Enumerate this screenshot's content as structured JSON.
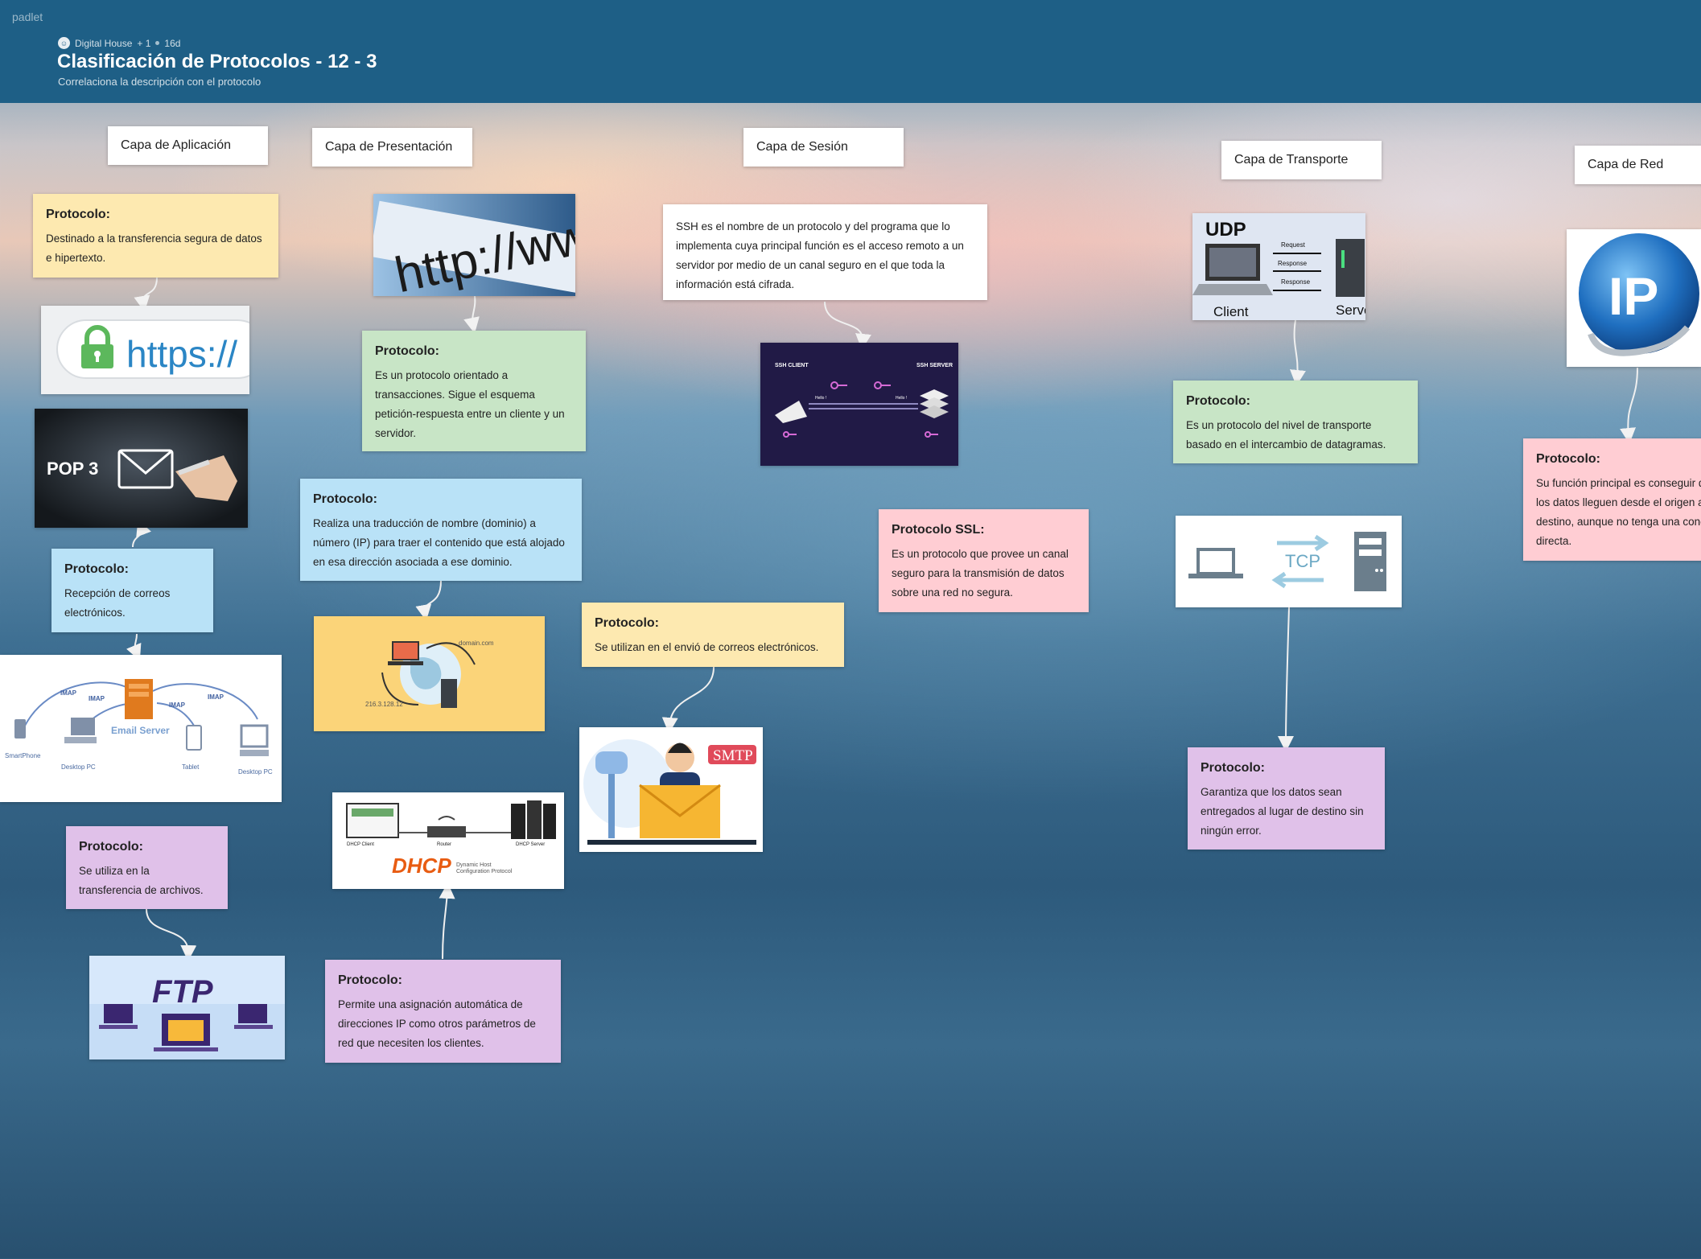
{
  "header": {
    "brand": "padlet",
    "author": "Digital House",
    "plus_count": "+ 1",
    "age": "16d",
    "title": "Clasificación de Protocolos - 12 - 3",
    "subtitle": "Correlaciona la descripción con el protocolo"
  },
  "columns": {
    "aplicacion": "Capa de Aplicación",
    "presentacion": "Capa de Presentación",
    "sesion": "Capa de Sesión",
    "transporte": "Capa de Transporte",
    "red": "Capa de Red"
  },
  "notes": {
    "https_title": "Protocolo:",
    "https_body": "Destinado a la transferencia segura de datos e hipertexto.",
    "pop3_title": "Protocolo:",
    "pop3_body": "Recepción de correos electrónicos.",
    "ftp_title": "Protocolo:",
    "ftp_body": "Se utiliza en la transferencia de archivos.",
    "http_title": "Protocolo:",
    "http_body": "Es un protocolo orientado a transacciones. Sigue el esquema petición-respuesta entre un cliente y un servidor.",
    "dns_title": "Protocolo:",
    "dns_body": "Realiza una traducción de nombre (dominio) a número (IP) para traer el contenido que está alojado en esa dirección asociada a ese dominio.",
    "dhcp_title": "Protocolo:",
    "dhcp_body": "Permite una asignación automática de direcciones IP como otros parámetros de red que necesiten los clientes.",
    "smtp_title": "Protocolo:",
    "smtp_body": "Se utilizan en el envió de correos electrónicos.",
    "ssh_body": "SSH es el nombre de un protocolo y del programa que lo implementa cuya principal función es el acceso remoto a un servidor por medio de un canal seguro en el que toda la información está cifrada.",
    "ssl_title": "Protocolo SSL:",
    "ssl_body": "Es un protocolo que provee un canal seguro para la transmisión de datos sobre una red no segura.",
    "udp_title": "Protocolo:",
    "udp_body": "Es un protocolo del nivel de transporte basado en el intercambio de datagramas.",
    "tcp_title": "Protocolo:",
    "tcp_body": "Garantiza que los datos sean entregados al lugar de destino sin ningún error.",
    "ip_title": "Protocolo:",
    "ip_body": "Su función principal es conseguir que los datos lleguen desde el origen al destino, aunque no tenga una conexión directa."
  },
  "images": {
    "https_text": "https://",
    "pop3_text": "POP 3",
    "http_text": "http://www",
    "imap_label": "IMAP",
    "email_server": "Email Server",
    "smartphone": "SmartPhone",
    "desktop_pc": "Desktop PC",
    "tablet": "Tablet",
    "ftp_text": "FTP",
    "domain_text": "domain.com",
    "ip_text": "216.3.128.12",
    "dhcp_text": "DHCP",
    "dhcp_sub1": "Dynamic Host",
    "dhcp_sub2": "Configuration Protocol",
    "dhcp_client": "DHCP Client",
    "router": "Router",
    "dhcp_server": "DHCP Server",
    "smtp_text": "SMTP",
    "ssh_client": "SSH CLIENT",
    "ssh_server": "SSH SERVER",
    "hello": "Hello !",
    "udp_text": "UDP",
    "request": "Request",
    "response": "Response",
    "client": "Client",
    "server": "Server",
    "tcp_text": "TCP",
    "ip_logo": "IP"
  },
  "colors": {
    "header_bg": "#1e5f86",
    "yellow_note": "#fde9b0",
    "green_note": "#c8e5c6",
    "blue_note": "#b9e2f7",
    "purple_note": "#e0c1e9",
    "pink_note": "#ffcdd3"
  }
}
